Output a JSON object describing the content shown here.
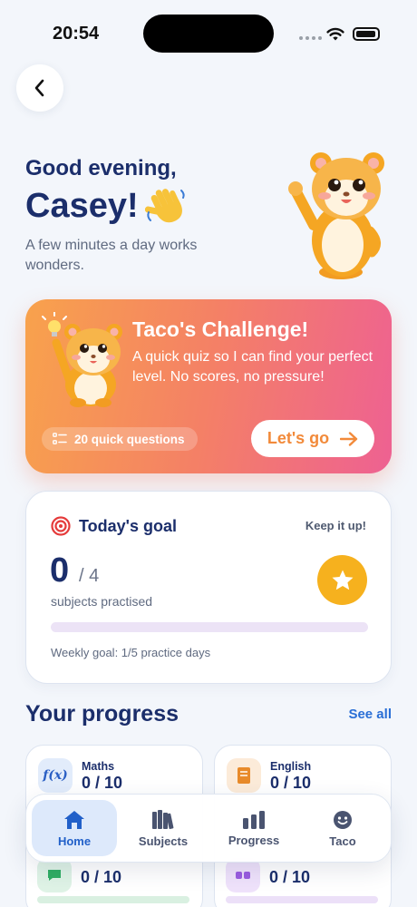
{
  "status_bar": {
    "time": "20:54"
  },
  "greeting": {
    "line1": "Good evening,",
    "name": "Casey!",
    "subtitle": "A few minutes a day works wonders."
  },
  "challenge": {
    "title": "Taco's Challenge!",
    "description": "A quick quiz so I can find your perfect level. No scores, no pressure!",
    "pill": "20 quick questions",
    "cta": "Let's go"
  },
  "goal": {
    "title": "Today's goal",
    "badge": "Keep it up!",
    "done": "0",
    "total": "/ 4",
    "caption": "subjects practised",
    "progress": 0,
    "weekly": "Weekly goal: 1/5 practice days"
  },
  "progress": {
    "title": "Your progress",
    "see_all": "See all",
    "subjects": [
      {
        "name": "Maths",
        "score": "0 / 10",
        "icon": "function-icon"
      },
      {
        "name": "English",
        "score": "0 / 10",
        "icon": "book-icon"
      },
      {
        "name": "",
        "score": "0 / 10",
        "icon": "chat-icon"
      },
      {
        "name": "",
        "score": "0 / 10",
        "icon": "blocks-icon"
      }
    ]
  },
  "nav": {
    "items": [
      {
        "label": "Home",
        "icon": "home-icon",
        "active": true
      },
      {
        "label": "Subjects",
        "icon": "books-icon"
      },
      {
        "label": "Progress",
        "icon": "bar-chart-icon"
      },
      {
        "label": "Taco",
        "icon": "smiley-icon"
      }
    ]
  },
  "colors": {
    "primary_text": "#1b2e6b",
    "accent_blue": "#2a6fd6",
    "challenge_gradient": [
      "#f8a24c",
      "#ee6192"
    ],
    "star": "#f6b11e"
  }
}
